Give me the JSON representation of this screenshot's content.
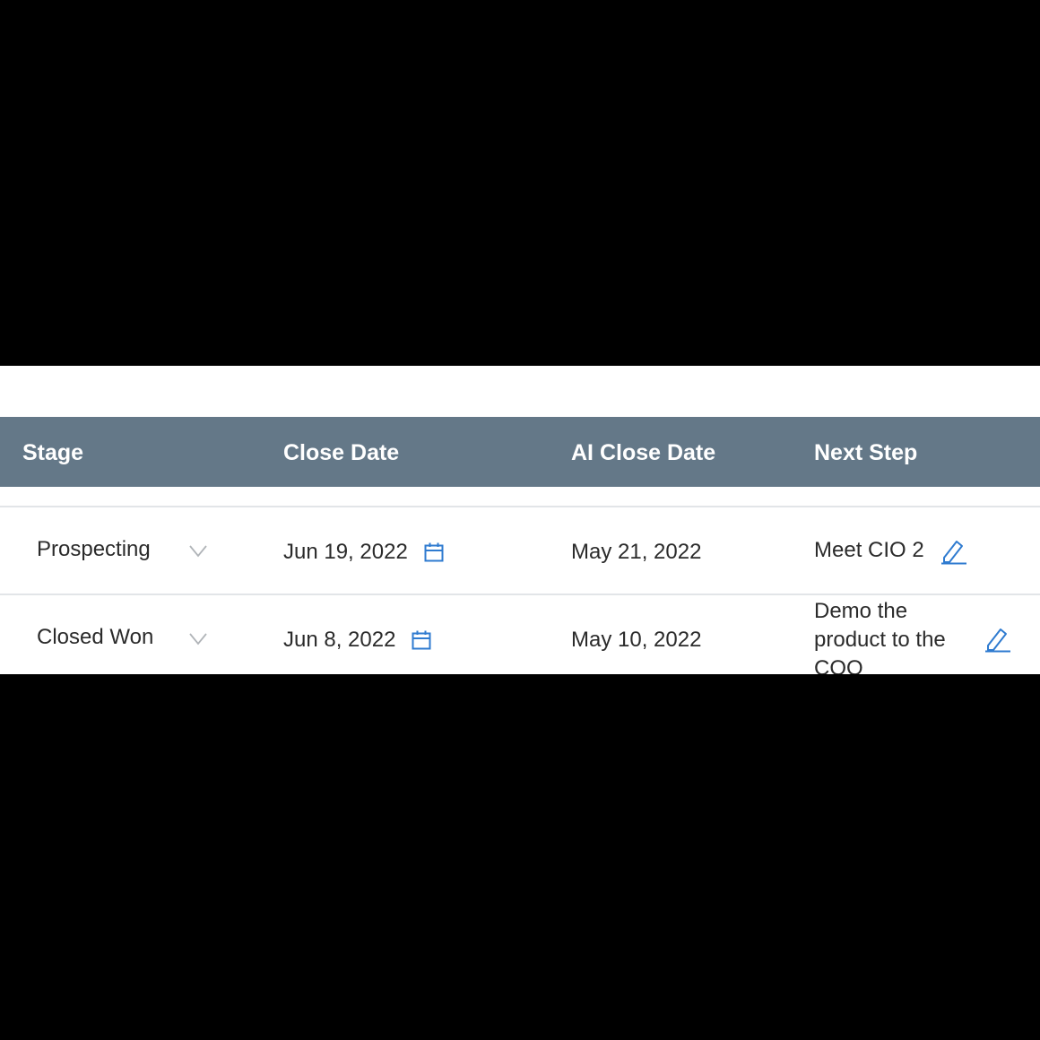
{
  "table": {
    "columns": [
      "Stage",
      "Close Date",
      "AI Close Date",
      "Next Step"
    ],
    "rows": [
      {
        "stage": "Prospecting",
        "close_date": "Jun 19, 2022",
        "ai_close_date": "May 21, 2022",
        "next_step_lines": [
          "Meet CIO 2"
        ]
      },
      {
        "stage": "Closed Won",
        "close_date": "Jun 8, 2022",
        "ai_close_date": "May 10, 2022",
        "next_step_lines": [
          "Demo the",
          "product to the",
          "COO"
        ]
      }
    ]
  },
  "colors": {
    "header_bg": "#647888",
    "accent": "#2f7bd0",
    "chevron": "#b0b4b8",
    "row_border": "#e2e5e8"
  },
  "icons": {
    "dropdown": "chevron-down-icon",
    "date_picker": "calendar-icon",
    "edit": "pencil-icon"
  }
}
